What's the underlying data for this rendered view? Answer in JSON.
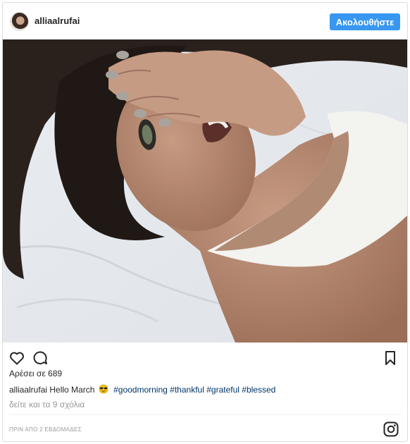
{
  "post": {
    "username": "alliaalrufai",
    "follow_label": "Ακολουθήστε",
    "likes_text": "Αρέσει σε 689",
    "caption": {
      "username": "alliaalrufai",
      "text": "Hello March",
      "emoji": "sunglasses-emoji",
      "hashtags": [
        "#goodmorning",
        "#thankful",
        "#grateful",
        "#blessed"
      ]
    },
    "comments_link": "δείτε και τα 9 σχόλια",
    "timestamp": "ΠΡΙΝ ΑΠΟ 2 ΕΒΔΟΜΑΔΕΣ"
  },
  "icons": {
    "heart": "heart-icon",
    "comment": "comment-icon",
    "bookmark": "bookmark-icon",
    "instagram": "instagram-icon"
  },
  "colors": {
    "follow_button": "#3897f0",
    "hashtag": "#003569",
    "muted": "#999999"
  }
}
